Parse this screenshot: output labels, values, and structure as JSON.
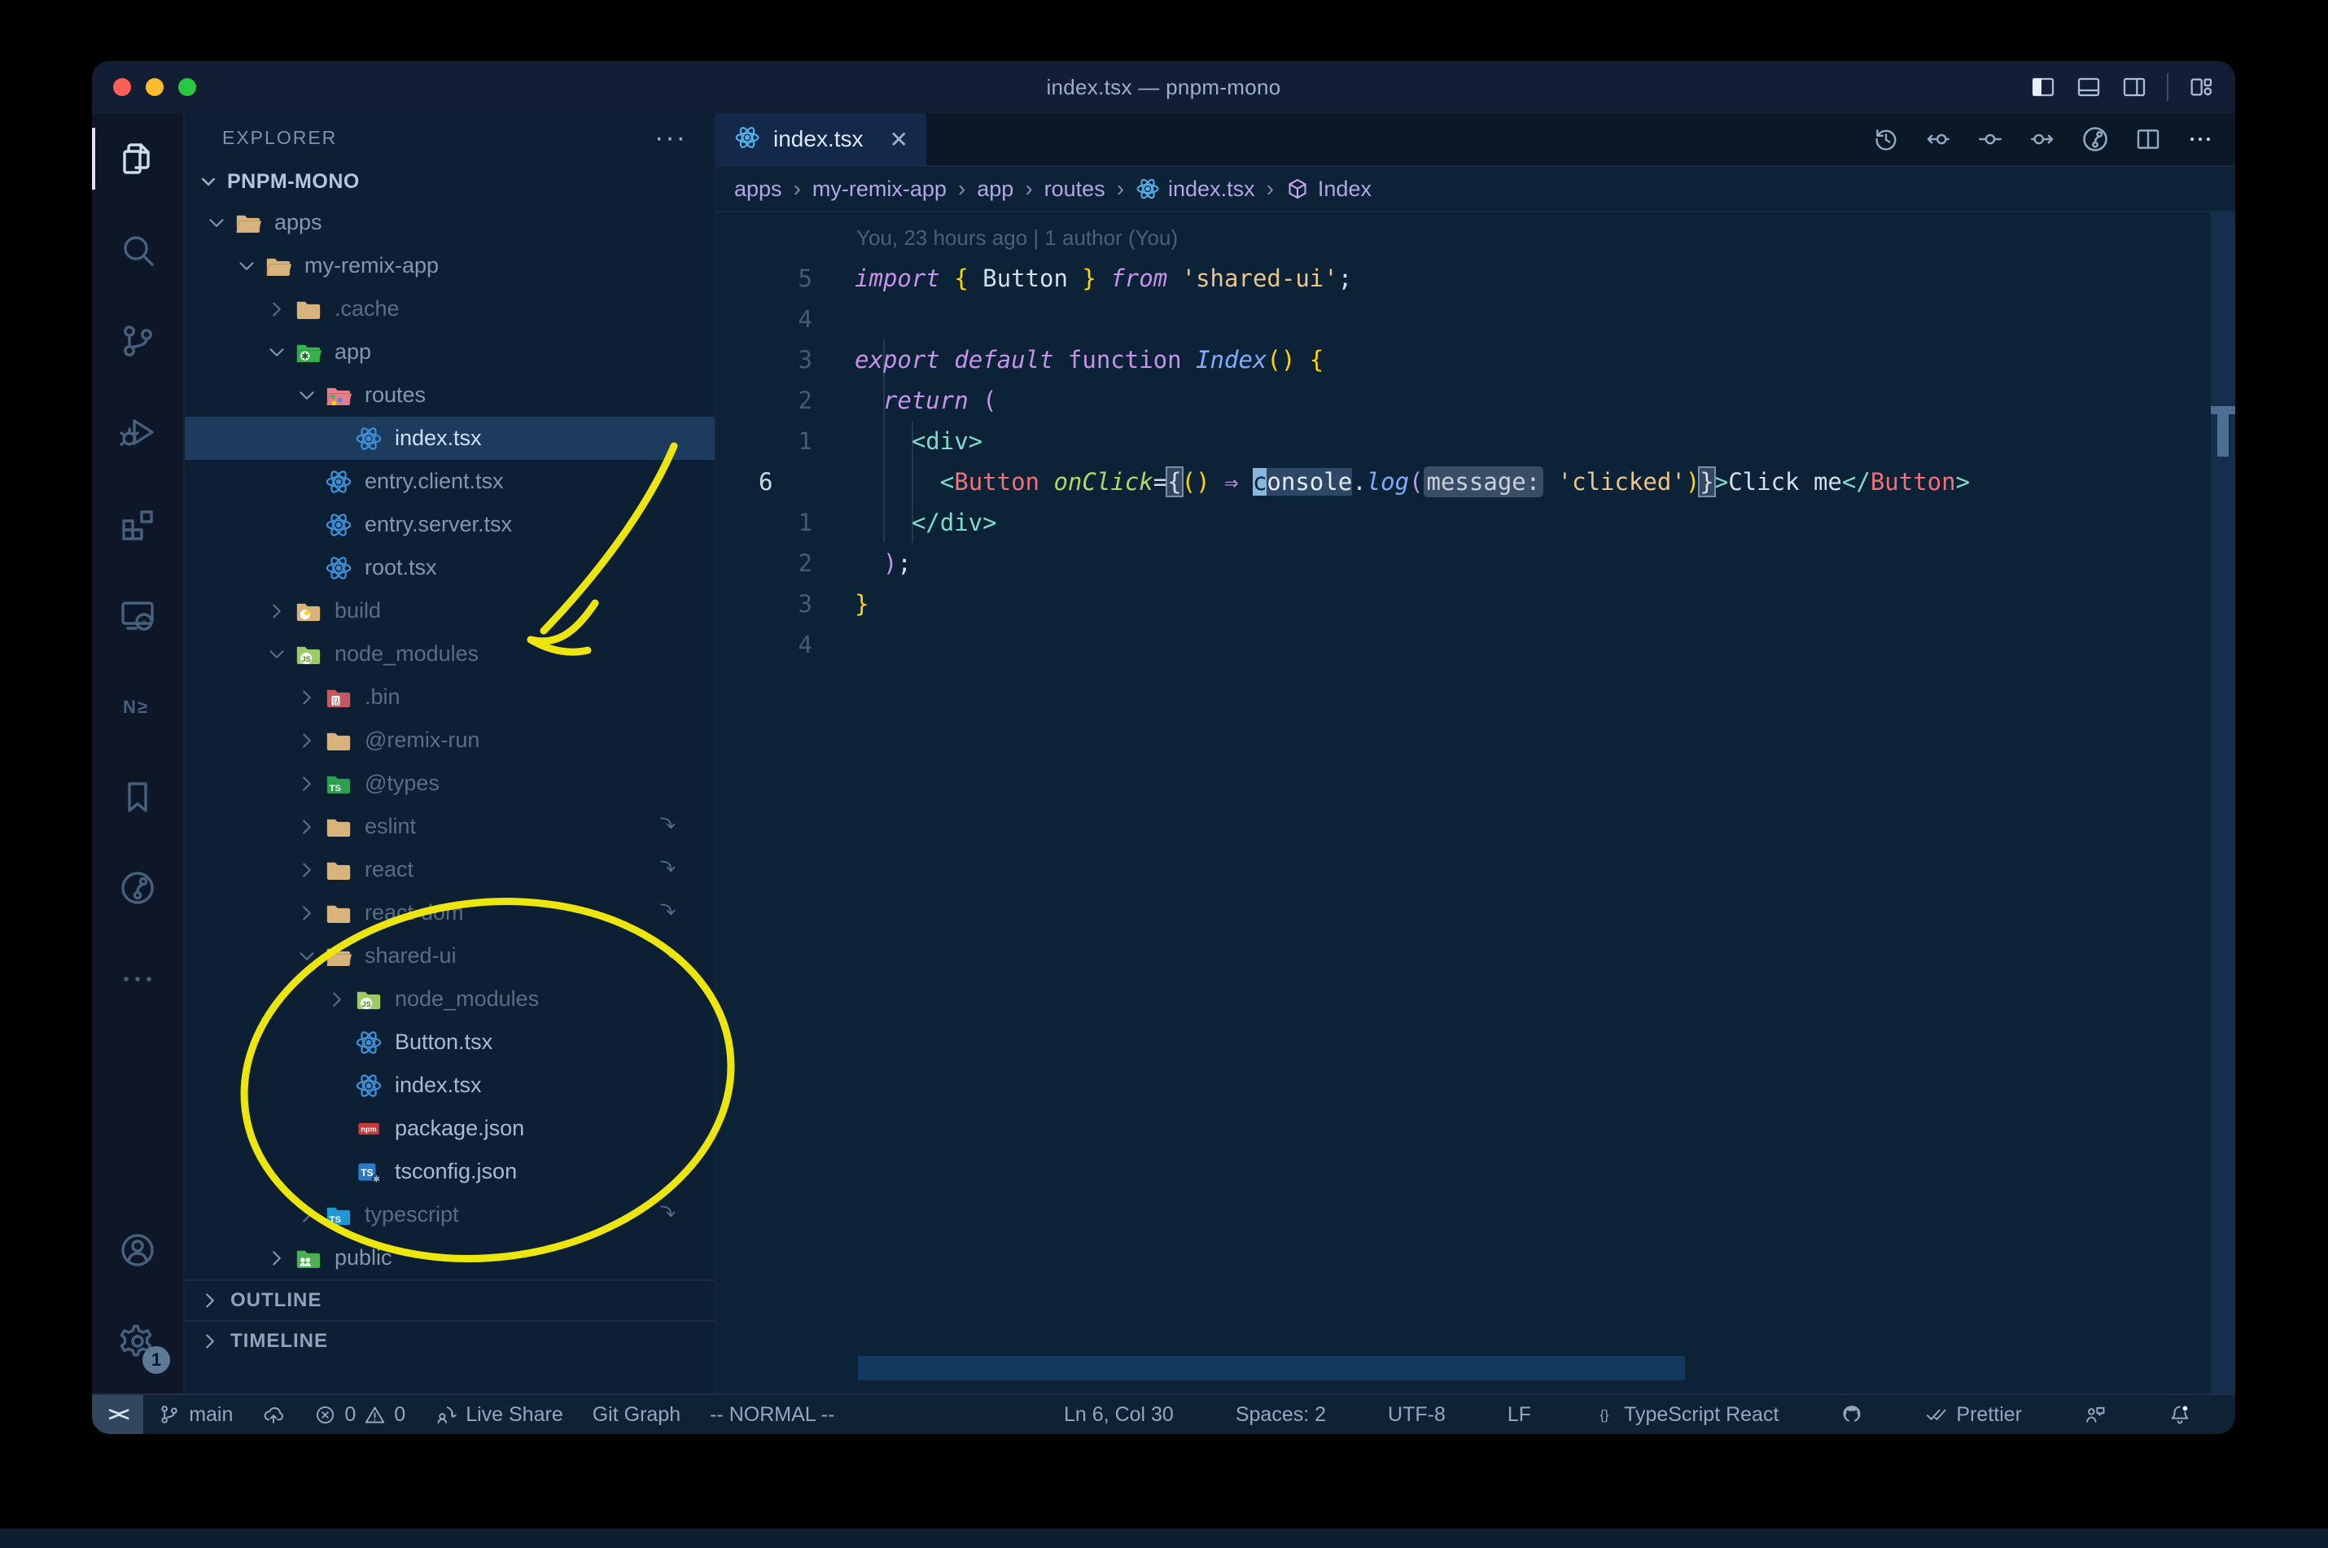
{
  "window": {
    "title": "index.tsx — pnpm-mono"
  },
  "traffic_lights": {
    "close": "#ff5f57",
    "minimize": "#febc2e",
    "zoom": "#28c840"
  },
  "titlebar_icons": [
    {
      "name": "toggle-primary-sidebar",
      "active": true
    },
    {
      "name": "toggle-panel",
      "active": false
    },
    {
      "name": "toggle-secondary-sidebar",
      "active": false
    },
    {
      "name": "customize-layout",
      "active": false
    }
  ],
  "activity_bar": {
    "top": [
      {
        "name": "explorer",
        "active": true
      },
      {
        "name": "search"
      },
      {
        "name": "source-control"
      },
      {
        "name": "run-debug"
      },
      {
        "name": "extensions"
      },
      {
        "name": "remote-explorer"
      },
      {
        "name": "nx-console"
      },
      {
        "name": "bookmarks"
      },
      {
        "name": "gitlens"
      },
      {
        "name": "more"
      }
    ],
    "bottom": [
      {
        "name": "accounts"
      },
      {
        "name": "settings",
        "badge": "1"
      }
    ]
  },
  "explorer": {
    "header": "EXPLORER",
    "header_more": "···",
    "root": "PNPM-MONO",
    "items": [
      {
        "label": "apps",
        "depth": 1,
        "kind": "folder",
        "expanded": true,
        "icon": "folder-tan-open"
      },
      {
        "label": "my-remix-app",
        "depth": 2,
        "kind": "folder",
        "expanded": true,
        "icon": "folder-tan-open"
      },
      {
        "label": ".cache",
        "depth": 3,
        "kind": "folder",
        "expanded": false,
        "icon": "folder-tan",
        "dim": true
      },
      {
        "label": "app",
        "depth": 3,
        "kind": "folder",
        "expanded": true,
        "icon": "folder-app"
      },
      {
        "label": "routes",
        "depth": 4,
        "kind": "folder",
        "expanded": true,
        "icon": "folder-routes"
      },
      {
        "label": "index.tsx",
        "depth": 5,
        "kind": "file",
        "icon": "file-react",
        "selected": true
      },
      {
        "label": "entry.client.tsx",
        "depth": 4,
        "kind": "file",
        "icon": "file-react"
      },
      {
        "label": "entry.server.tsx",
        "depth": 4,
        "kind": "file",
        "icon": "file-react"
      },
      {
        "label": "root.tsx",
        "depth": 4,
        "kind": "file",
        "icon": "file-react"
      },
      {
        "label": "build",
        "depth": 3,
        "kind": "folder",
        "expanded": false,
        "icon": "folder-build",
        "dim": true
      },
      {
        "label": "node_modules",
        "depth": 3,
        "kind": "folder",
        "expanded": true,
        "icon": "folder-node-modules",
        "dim": true
      },
      {
        "label": ".bin",
        "depth": 4,
        "kind": "folder",
        "expanded": false,
        "icon": "folder-bin",
        "dim": true
      },
      {
        "label": "@remix-run",
        "depth": 4,
        "kind": "folder",
        "expanded": false,
        "icon": "folder-tan",
        "dim": true
      },
      {
        "label": "@types",
        "depth": 4,
        "kind": "folder",
        "expanded": false,
        "icon": "folder-types",
        "dim": true
      },
      {
        "label": "eslint",
        "depth": 4,
        "kind": "folder",
        "expanded": false,
        "icon": "folder-tan",
        "dim": true,
        "symlink": true
      },
      {
        "label": "react",
        "depth": 4,
        "kind": "folder",
        "expanded": false,
        "icon": "folder-tan",
        "dim": true,
        "symlink": true
      },
      {
        "label": "react-dom",
        "depth": 4,
        "kind": "folder",
        "expanded": false,
        "icon": "folder-tan",
        "dim": true,
        "symlink": true
      },
      {
        "label": "shared-ui",
        "depth": 4,
        "kind": "folder",
        "expanded": true,
        "icon": "folder-tan-open",
        "dim": true,
        "symlink": true
      },
      {
        "label": "node_modules",
        "depth": 5,
        "kind": "folder",
        "expanded": false,
        "icon": "folder-node-modules",
        "dim": true
      },
      {
        "label": "Button.tsx",
        "depth": 5,
        "kind": "file",
        "icon": "file-react",
        "bright": true
      },
      {
        "label": "index.tsx",
        "depth": 5,
        "kind": "file",
        "icon": "file-react",
        "bright": true
      },
      {
        "label": "package.json",
        "depth": 5,
        "kind": "file",
        "icon": "file-npm",
        "bright": true
      },
      {
        "label": "tsconfig.json",
        "depth": 5,
        "kind": "file",
        "icon": "file-tsconfig",
        "bright": true
      },
      {
        "label": "typescript",
        "depth": 4,
        "kind": "folder",
        "expanded": false,
        "icon": "folder-ts",
        "dim": true,
        "symlink": true
      },
      {
        "label": "public",
        "depth": 3,
        "kind": "folder",
        "expanded": false,
        "icon": "folder-public"
      }
    ],
    "sections": [
      {
        "label": "OUTLINE"
      },
      {
        "label": "TIMELINE"
      }
    ]
  },
  "tab": {
    "label": "index.tsx",
    "close": "✕",
    "icon": "react"
  },
  "editor_actions": [
    {
      "name": "timeline-history"
    },
    {
      "name": "previous-change"
    },
    {
      "name": "current-change"
    },
    {
      "name": "next-change"
    },
    {
      "name": "gitlens-graph"
    },
    {
      "name": "split-editor"
    },
    {
      "name": "more-actions"
    }
  ],
  "breadcrumbs": [
    {
      "label": "apps"
    },
    {
      "label": "my-remix-app"
    },
    {
      "label": "app"
    },
    {
      "label": "routes"
    },
    {
      "label": "index.tsx",
      "icon": "react-bc"
    },
    {
      "label": "Index",
      "icon": "symbol-namespace"
    }
  ],
  "editor": {
    "blame": "You, 23 hours ago | 1 author (You)",
    "lines": [
      {
        "num": "5",
        "tokens": [
          [
            "import",
            "kwi"
          ],
          [
            " ",
            "pl"
          ],
          [
            "{",
            "brace"
          ],
          [
            " Button ",
            "pl"
          ],
          [
            "}",
            "brace"
          ],
          [
            " ",
            "pl"
          ],
          [
            "from",
            "kwi"
          ],
          [
            " ",
            "pl"
          ],
          [
            "'shared-ui'",
            "str"
          ],
          [
            ";",
            "pl"
          ]
        ]
      },
      {
        "num": "4",
        "tokens": []
      },
      {
        "num": "3",
        "tokens": [
          [
            "export",
            "kwi"
          ],
          [
            " ",
            "pl"
          ],
          [
            "default",
            "kwi"
          ],
          [
            " ",
            "pl"
          ],
          [
            "function",
            "kw"
          ],
          [
            " ",
            "pl"
          ],
          [
            "Index",
            "funci"
          ],
          [
            "()",
            "brace"
          ],
          [
            " ",
            "pl"
          ],
          [
            "{",
            "brace"
          ]
        ]
      },
      {
        "num": "2",
        "tokens": [
          [
            "  ",
            "pl"
          ],
          [
            "return",
            "kwi"
          ],
          [
            " ",
            "pl"
          ],
          [
            "(",
            "kw"
          ]
        ]
      },
      {
        "num": "1",
        "tokens": [
          [
            "    ",
            "pl"
          ],
          [
            "<div>",
            "tag"
          ]
        ]
      },
      {
        "num": "6",
        "current": true,
        "tokens": [
          [
            "      ",
            "pl"
          ],
          [
            "<",
            "tag"
          ],
          [
            "Button",
            "comp"
          ],
          [
            " ",
            "pl"
          ],
          [
            "onClick",
            "attri"
          ],
          [
            "=",
            "pl"
          ],
          [
            "{",
            "boxed"
          ],
          [
            "()",
            "brace"
          ],
          [
            " ",
            "pl"
          ],
          [
            "⇒",
            "kwi"
          ],
          [
            " ",
            "pl"
          ],
          [
            "c",
            "cursor"
          ],
          [
            "onsole",
            "hl"
          ],
          [
            ".",
            "pl"
          ],
          [
            "log",
            "funci"
          ],
          [
            "(",
            "kw"
          ],
          [
            "message:",
            "inlay"
          ],
          [
            " ",
            "pl"
          ],
          [
            "'clicked'",
            "str"
          ],
          [
            ")",
            "brace"
          ],
          [
            "}",
            "boxed"
          ],
          [
            ">",
            "tag"
          ],
          [
            "Click me",
            "pl"
          ],
          [
            "</",
            "tag"
          ],
          [
            "Button",
            "comp"
          ],
          [
            ">",
            "tag"
          ]
        ]
      },
      {
        "num": "1",
        "tokens": [
          [
            "    ",
            "pl"
          ],
          [
            "</div>",
            "tag"
          ]
        ]
      },
      {
        "num": "2",
        "tokens": [
          [
            "  ",
            "pl"
          ],
          [
            ")",
            "kw"
          ],
          [
            ";",
            "pl"
          ]
        ]
      },
      {
        "num": "3",
        "tokens": [
          [
            "}",
            "brace"
          ]
        ]
      },
      {
        "num": "4",
        "tokens": []
      }
    ]
  },
  "status_bar": {
    "left": [
      {
        "name": "remote-indicator",
        "remote_box": true,
        "parts": [
          {
            "text": "><"
          }
        ]
      },
      {
        "name": "git-branch",
        "parts": [
          {
            "icon": "branch"
          },
          {
            "text": "main"
          }
        ]
      },
      {
        "name": "publish-changes",
        "parts": [
          {
            "icon": "cloud-upload"
          }
        ]
      },
      {
        "name": "problems",
        "parts": [
          {
            "icon": "error"
          },
          {
            "text": "0"
          },
          {
            "icon": "warning"
          },
          {
            "text": "0"
          }
        ]
      },
      {
        "name": "live-share",
        "parts": [
          {
            "icon": "live-share"
          },
          {
            "text": "Live Share"
          }
        ]
      },
      {
        "name": "git-graph",
        "parts": [
          {
            "text": "Git Graph"
          }
        ]
      },
      {
        "name": "vim-mode",
        "parts": [
          {
            "text": "-- NORMAL --"
          }
        ]
      }
    ],
    "right": [
      {
        "name": "cursor-position",
        "parts": [
          {
            "text": "Ln 6, Col 30"
          }
        ]
      },
      {
        "name": "indentation",
        "parts": [
          {
            "text": "Spaces: 2"
          }
        ]
      },
      {
        "name": "encoding",
        "parts": [
          {
            "text": "UTF-8"
          }
        ]
      },
      {
        "name": "eol",
        "parts": [
          {
            "text": "LF"
          }
        ]
      },
      {
        "name": "language-mode",
        "parts": [
          {
            "icon": "braces"
          },
          {
            "text": "TypeScript React"
          }
        ]
      },
      {
        "name": "github",
        "parts": [
          {
            "icon": "octoface"
          }
        ]
      },
      {
        "name": "prettier",
        "parts": [
          {
            "icon": "double-check"
          },
          {
            "text": "Prettier"
          }
        ]
      },
      {
        "name": "feedback",
        "parts": [
          {
            "icon": "feedback"
          }
        ]
      },
      {
        "name": "notifications",
        "parts": [
          {
            "icon": "bell-dot"
          }
        ]
      }
    ]
  },
  "colors": {
    "annotation": "#ede60e",
    "selection_row": "#1d3b5c",
    "syntax": {
      "pl": "#d6deeb",
      "kw": "#c792ea",
      "func": "#82aaff",
      "str": "#ecc48d",
      "brace": "#ffd602",
      "tag": "#7fdbca",
      "comp": "#f07178",
      "attr": "#addb67"
    }
  }
}
